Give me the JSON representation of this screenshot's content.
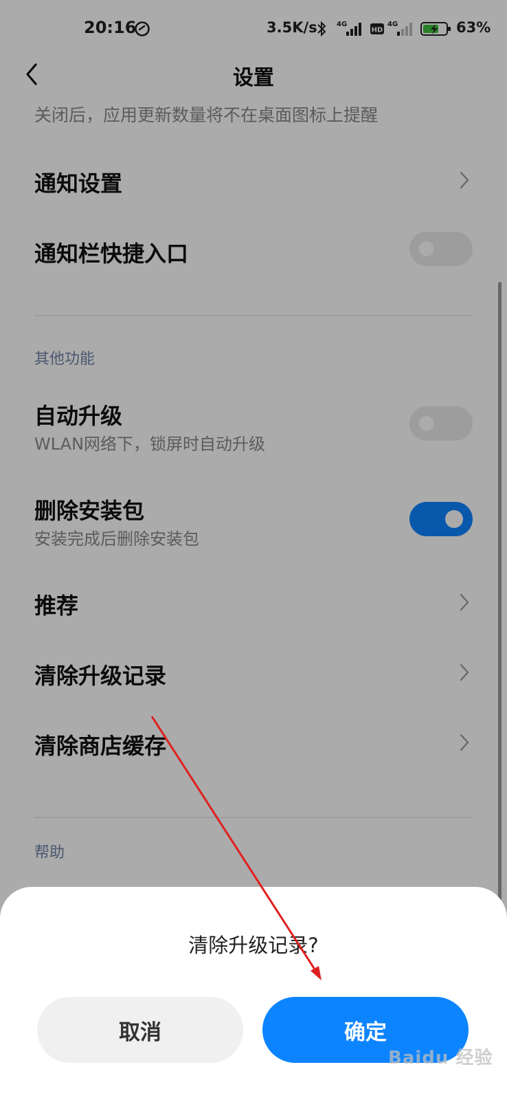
{
  "status_bar": {
    "time": "20:16",
    "net_speed": "3.5K/s",
    "sig1_label": "4G",
    "hd_label": "HD",
    "sig2_label": "4G",
    "battery_pct": "63%"
  },
  "header": {
    "title": "设置"
  },
  "hint_text": "关闭后，应用更新数量将不在桌面图标上提醒",
  "rows": {
    "notify_settings": {
      "label": "通知设置"
    },
    "notify_shortcut": {
      "label": "通知栏快捷入口",
      "toggle": false
    },
    "other_section": "其他功能",
    "auto_upgrade": {
      "label": "自动升级",
      "sub": "WLAN网络下，锁屏时自动升级",
      "toggle": false
    },
    "delete_pkg": {
      "label": "删除安装包",
      "sub": "安装完成后删除安装包",
      "toggle": true
    },
    "recommend": {
      "label": "推荐"
    },
    "clear_records": {
      "label": "清除升级记录"
    },
    "clear_cache": {
      "label": "清除商店缓存"
    },
    "help_section": "帮助"
  },
  "dialog": {
    "title": "清除升级记录?",
    "cancel": "取消",
    "confirm": "确定"
  },
  "watermark": "Baidu 经验",
  "colors": {
    "accent": "#0d84ff",
    "annotation_arrow": "#e02020"
  }
}
